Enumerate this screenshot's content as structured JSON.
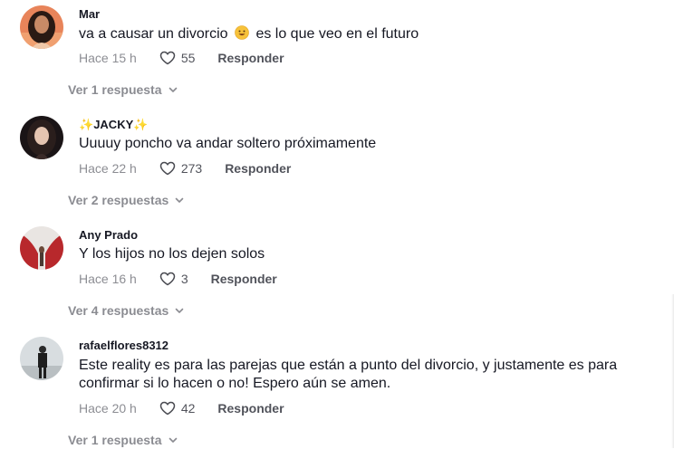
{
  "comments": [
    {
      "username": "Mar",
      "text_before": "va a causar un divorcio",
      "text_after": "es lo que veo en el futuro",
      "emoji": "grinning-face-emoji",
      "time": "Hace 15 h",
      "likes": "55",
      "reply_label": "Responder",
      "view_replies": "Ver 1 respuesta"
    },
    {
      "username_prefix": "✨",
      "username": "JACKY",
      "username_suffix": "✨",
      "text": "Uuuuy poncho va andar soltero próximamente",
      "time": "Hace 22 h",
      "likes": "273",
      "reply_label": "Responder",
      "view_replies": "Ver 2 respuestas"
    },
    {
      "username": "Any Prado",
      "text": "Y los hijos no los dejen solos",
      "time": "Hace 16 h",
      "likes": "3",
      "reply_label": "Responder",
      "view_replies": "Ver 4 respuestas"
    },
    {
      "username": "rafaelflores8312",
      "text_line1": "Este reality es para las parejas que están a punto del divorcio, y justamente es para",
      "text_line2": "confirmar si lo hacen o no! Espero aún se amen.",
      "time": "Hace 20 h",
      "likes": "42",
      "reply_label": "Responder",
      "view_replies": "Ver 1 respuesta"
    }
  ],
  "icons": {
    "like": "heart-outline-icon",
    "expand": "chevron-down-icon"
  },
  "colors": {
    "primary_text": "#161823",
    "secondary_text": "#8a8b91",
    "background": "#ffffff"
  }
}
